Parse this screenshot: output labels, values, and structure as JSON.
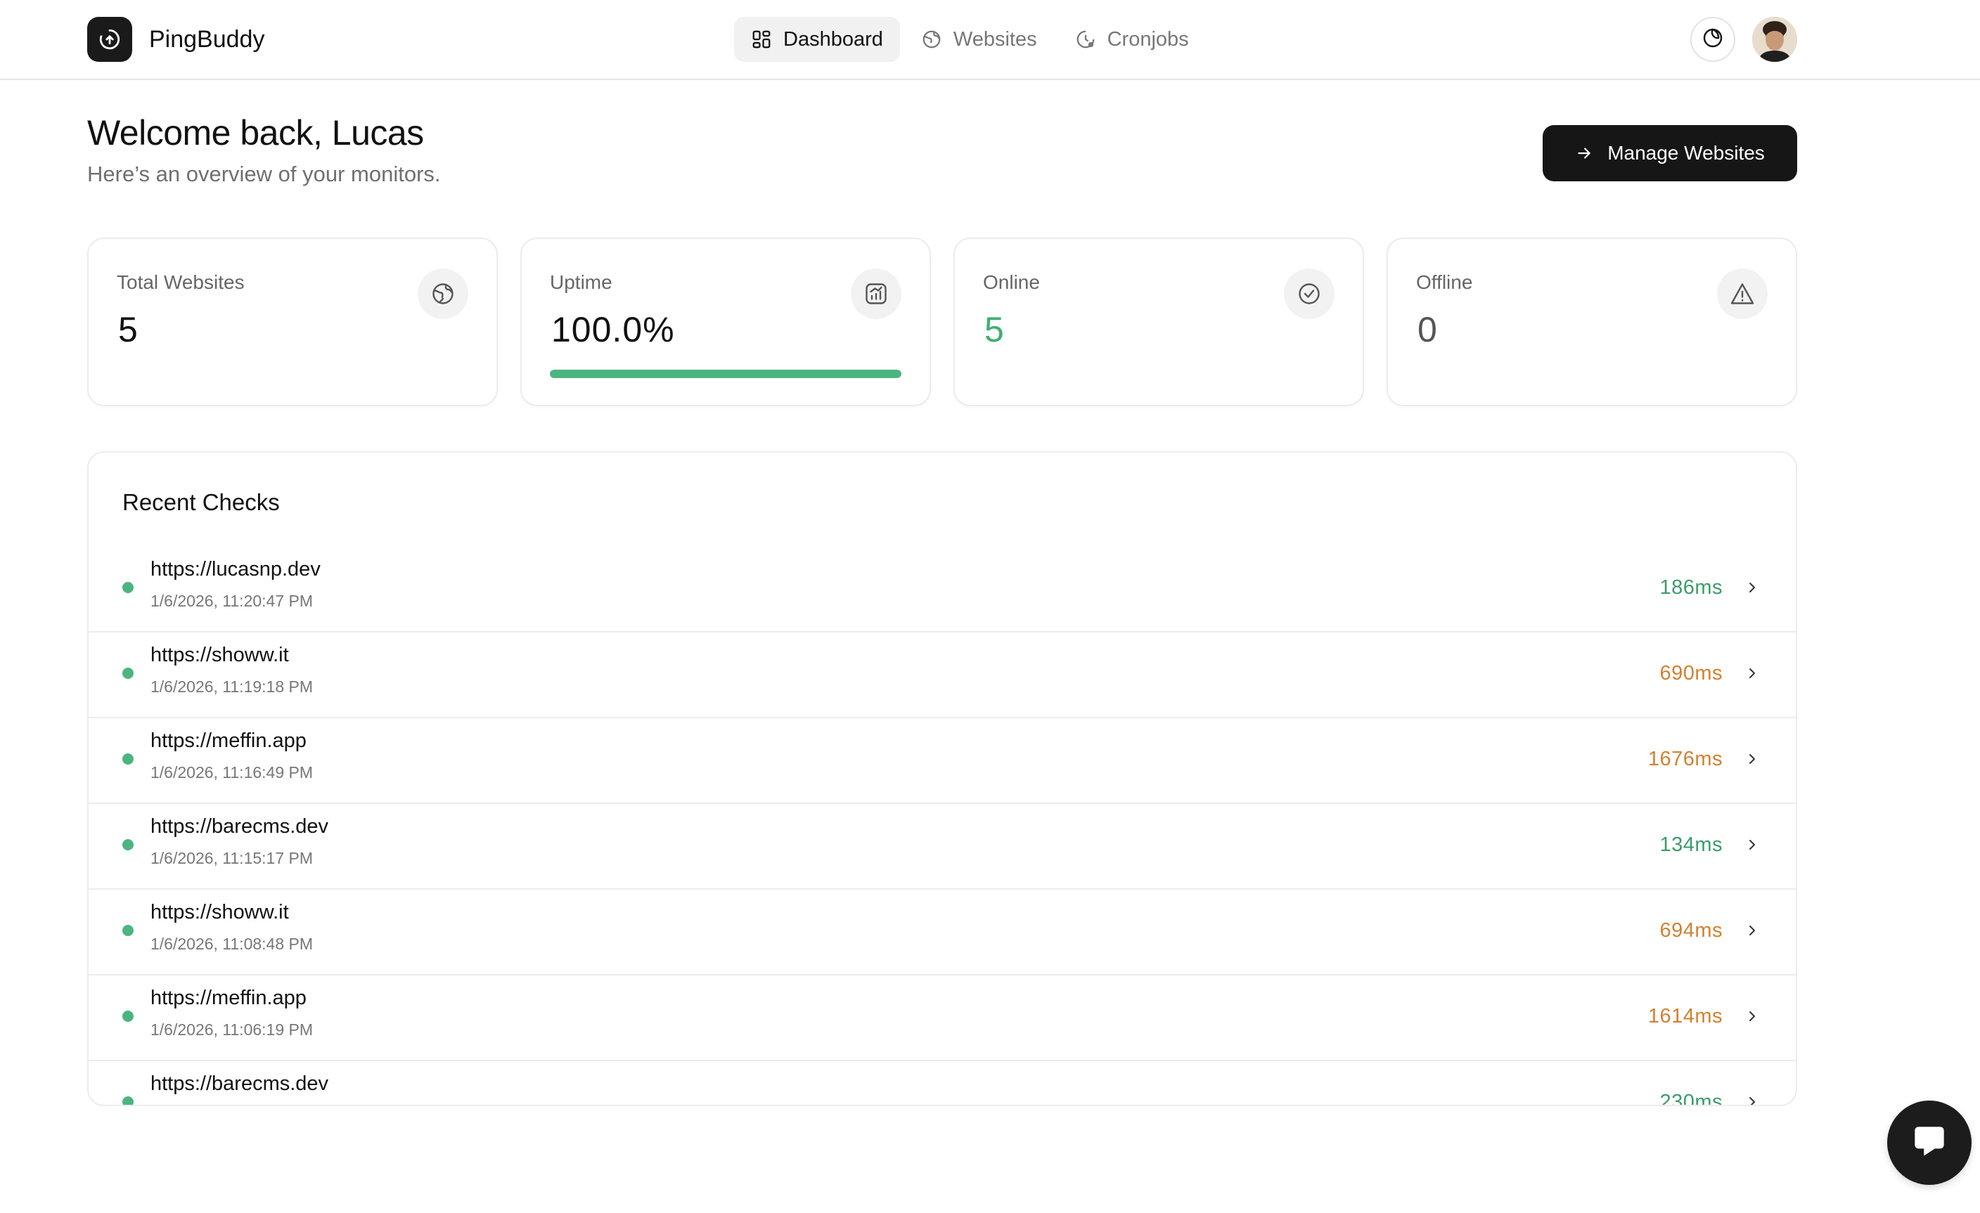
{
  "brand": {
    "name": "PingBuddy"
  },
  "nav": {
    "items": [
      {
        "label": "Dashboard",
        "icon": "dashboard-grid-icon",
        "active": true
      },
      {
        "label": "Websites",
        "icon": "globe-icon",
        "active": false
      },
      {
        "label": "Cronjobs",
        "icon": "clock-icon",
        "active": false
      }
    ]
  },
  "header": {
    "welcome": "Welcome back, Lucas",
    "subtitle": "Here’s an overview of your monitors.",
    "manage_button": "Manage Websites"
  },
  "stats": {
    "total": {
      "label": "Total Websites",
      "value": "5",
      "icon": "globe-icon"
    },
    "uptime": {
      "label": "Uptime",
      "value": "100.0%",
      "progress_fraction": 1.0,
      "icon": "chart-icon"
    },
    "online": {
      "label": "Online",
      "value": "5",
      "icon": "check-circle-icon"
    },
    "offline": {
      "label": "Offline",
      "value": "0",
      "icon": "warning-icon"
    }
  },
  "recent": {
    "title": "Recent Checks",
    "rows": [
      {
        "url": "https://lucasnp.dev",
        "time": "1/6/2026, 11:20:47 PM",
        "ms": "186ms",
        "speed": "fast"
      },
      {
        "url": "https://showw.it",
        "time": "1/6/2026, 11:19:18 PM",
        "ms": "690ms",
        "speed": "slow"
      },
      {
        "url": "https://meffin.app",
        "time": "1/6/2026, 11:16:49 PM",
        "ms": "1676ms",
        "speed": "slow"
      },
      {
        "url": "https://barecms.dev",
        "time": "1/6/2026, 11:15:17 PM",
        "ms": "134ms",
        "speed": "fast"
      },
      {
        "url": "https://showw.it",
        "time": "1/6/2026, 11:08:48 PM",
        "ms": "694ms",
        "speed": "slow"
      },
      {
        "url": "https://meffin.app",
        "time": "1/6/2026, 11:06:19 PM",
        "ms": "1614ms",
        "speed": "slow"
      },
      {
        "url": "https://barecms.dev",
        "time": "",
        "ms": "230ms",
        "speed": "fast"
      }
    ]
  },
  "colors": {
    "accent_green": "#4cb57f",
    "fast_text": "#3b9c6a",
    "slow_text": "#d4802f",
    "dark": "#161616"
  }
}
